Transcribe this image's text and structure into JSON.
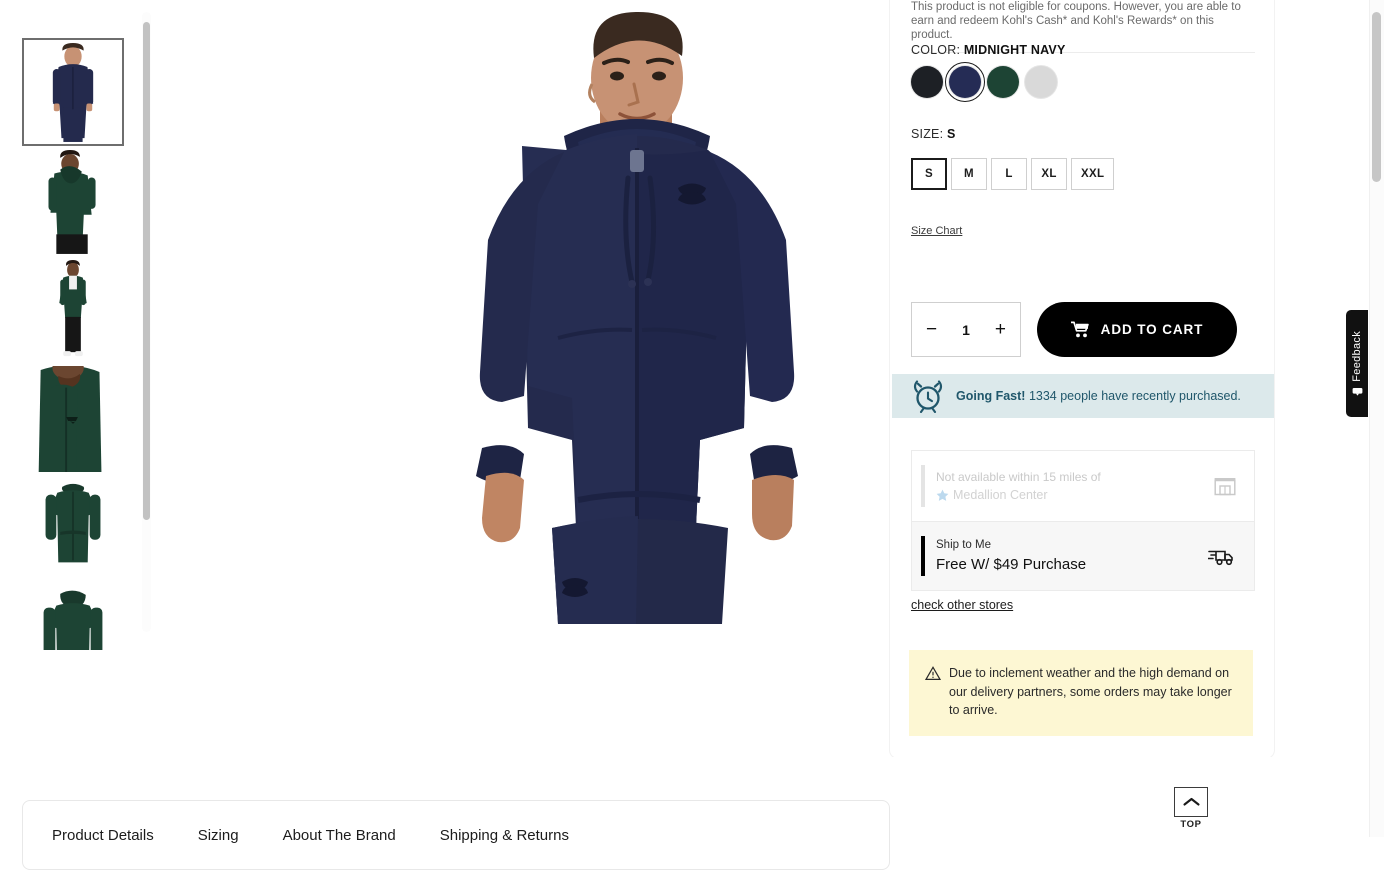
{
  "gallery": {
    "thumbnails": [
      {
        "alt": "Midnight Navy hoodie front on model",
        "selected": true,
        "garment": "#242a4d",
        "skin": "#c79274",
        "pants": "#242a4d"
      },
      {
        "alt": "Green hoodie back on model",
        "selected": false,
        "garment": "#1d4434",
        "skin": "#6b4630",
        "pants": "#161616"
      },
      {
        "alt": "Green hoodie full body on model",
        "selected": false,
        "garment": "#1d4434",
        "skin": "#6b4630",
        "pants": "#161616"
      },
      {
        "alt": "Green hoodie chest detail",
        "selected": false,
        "garment": "#1d4434",
        "skin": "#6b4630",
        "pants": "#1d4434"
      },
      {
        "alt": "Green hoodie flat front",
        "selected": false,
        "garment": "#1d4434",
        "skin": "#1d4434",
        "pants": "#1d4434"
      },
      {
        "alt": "Green hoodie flat back",
        "selected": false,
        "garment": "#1d4434",
        "skin": "#1d4434",
        "pants": "#1d4434"
      }
    ],
    "hero": {
      "alt": "Man wearing Midnight Navy Under Armour full-zip hoodie and joggers"
    }
  },
  "panel": {
    "coupon_note": "This product is not eligible for coupons. However, you are able to earn and redeem Kohl's Cash* and Kohl's Rewards* on this product.",
    "color": {
      "label_prefix": "COLOR:",
      "selected_name": "MIDNIGHT NAVY",
      "swatches": [
        {
          "name": "Black",
          "hex": "#1d2025",
          "selected": false
        },
        {
          "name": "Midnight Navy",
          "hex": "#252c55",
          "selected": true
        },
        {
          "name": "Forest Green",
          "hex": "#1d4434",
          "selected": false
        },
        {
          "name": "White Grey",
          "hex": "#d9d9d9",
          "selected": false
        }
      ]
    },
    "size": {
      "label_prefix": "SIZE:",
      "selected": "S",
      "options": [
        {
          "label": "S",
          "selected": true
        },
        {
          "label": "M",
          "selected": false
        },
        {
          "label": "L",
          "selected": false
        },
        {
          "label": "XL",
          "selected": false
        },
        {
          "label": "XXL",
          "selected": false
        }
      ],
      "size_chart_link": "Size Chart"
    },
    "quantity": {
      "value": "1",
      "decrement_label": "−",
      "increment_label": "+"
    },
    "add_to_cart": {
      "label": "ADD TO CART",
      "icon": "shopping-cart-icon"
    },
    "urgency_banner": {
      "icon": "alarm-clock-icon",
      "headline": "Going Fast!",
      "message": "1334 people have recently purchased.",
      "count": 1334,
      "bg_color": "#dce9eb",
      "text_color": "#20576b"
    },
    "fulfillment": {
      "pickup": {
        "line1": "Not available within 15 miles of",
        "store_name": "Medallion Center",
        "icon": "store-icon",
        "star_icon": "star-icon",
        "disabled": true
      },
      "ship": {
        "line1": "Ship to Me",
        "line2": "Free W/ $49 Purchase",
        "icon": "delivery-truck-icon",
        "selected": true
      },
      "check_other_stores_link": "check other stores"
    },
    "weather_notice": {
      "icon": "warning-triangle-icon",
      "message": "Due to inclement weather and the high demand on our delivery partners, some orders may take longer to arrive.",
      "bg_color": "#fdf7d3"
    }
  },
  "tabs": [
    {
      "label": "Product Details"
    },
    {
      "label": "Sizing"
    },
    {
      "label": "About The Brand"
    },
    {
      "label": "Shipping & Returns"
    }
  ],
  "back_to_top": {
    "label": "TOP",
    "icon": "chevron-up-icon"
  },
  "feedback_tab": {
    "label": "Feedback",
    "icon": "comment-icon"
  }
}
